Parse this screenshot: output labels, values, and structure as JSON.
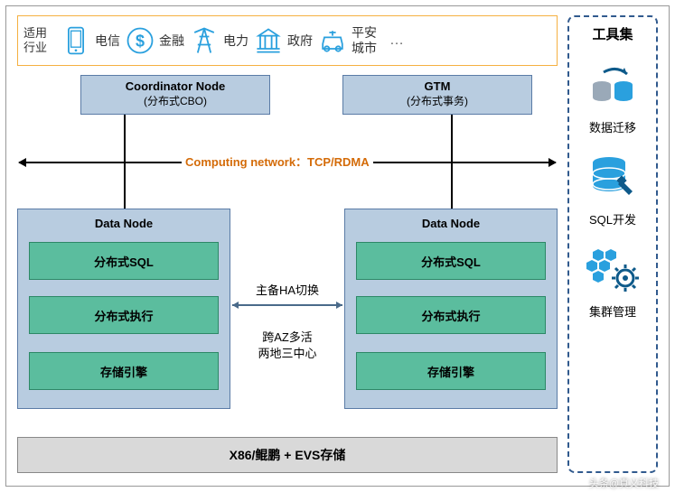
{
  "industries": {
    "label": "适用行业",
    "items": [
      {
        "icon": "phone-icon",
        "text": "电信"
      },
      {
        "icon": "dollar-icon",
        "text": "金融"
      },
      {
        "icon": "tower-icon",
        "text": "电力"
      },
      {
        "icon": "govt-icon",
        "text": "政府"
      },
      {
        "icon": "car-icon",
        "text": "平安城市"
      }
    ],
    "more": "…"
  },
  "coordinator": {
    "title": "Coordinator Node",
    "sub": "(分布式CBO)"
  },
  "gtm": {
    "title": "GTM",
    "sub": "(分布式事务)"
  },
  "network_label": "Computing network：TCP/RDMA",
  "datanode": {
    "title": "Data Node",
    "layers": [
      "分布式SQL",
      "分布式执行",
      "存储引擎"
    ]
  },
  "center": {
    "ha": "主备HA切换",
    "az1": "跨AZ多活",
    "az2": "两地三中心"
  },
  "bottom": "X86/鲲鹏 + EVS存储",
  "sidebar": {
    "title": "工具集",
    "items": [
      {
        "icon": "migrate-icon",
        "label": "数据迁移"
      },
      {
        "icon": "sqldev-icon",
        "label": "SQL开发"
      },
      {
        "icon": "cluster-icon",
        "label": "集群管理"
      }
    ]
  },
  "watermark": "头条@真义科技"
}
